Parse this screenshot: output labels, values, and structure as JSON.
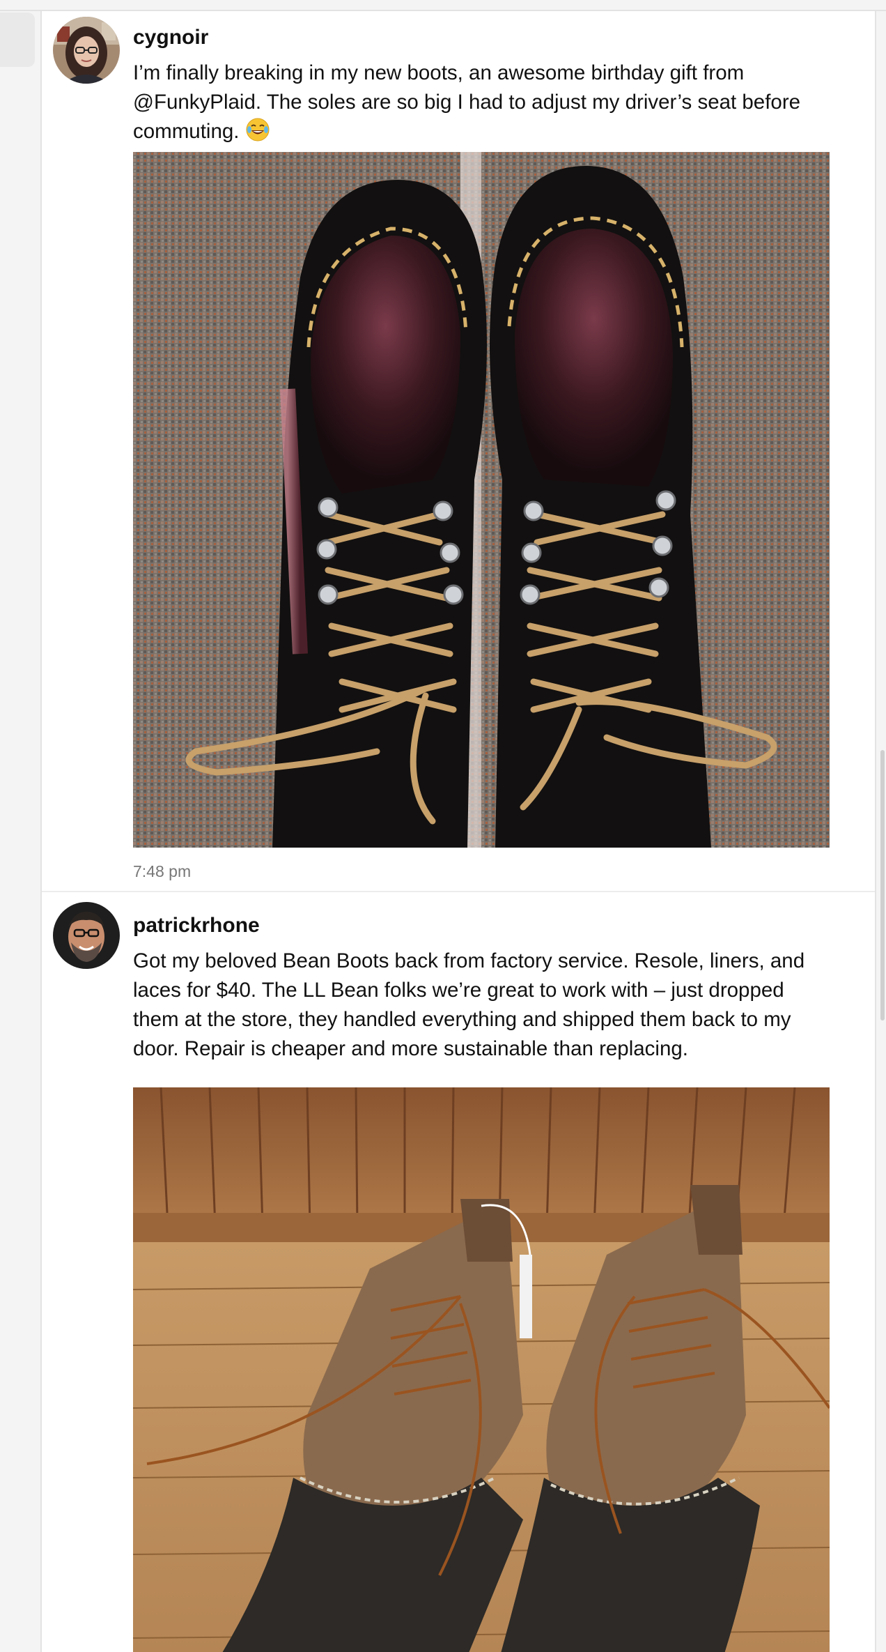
{
  "posts": [
    {
      "username": "cygnoir",
      "text_lines": [
        "I’m finally breaking in my new boots, an awesome birthday gift from",
        "@FunkyPlaid. The soles are so big I had to adjust my driver’s seat before",
        "commuting."
      ],
      "emoji": "face-with-tears-of-joy",
      "image": "black-cherry-leather-platform-boots-on-carpet",
      "timestamp": "7:48 pm"
    },
    {
      "username": "patrickrhone",
      "text_lines": [
        "Got my beloved Bean Boots back from factory service. Resole, liners, and",
        "laces for $40. The LL Bean folks we’re great to work with – just dropped",
        "them at the store, they handled everything and shipped them back to my",
        "door. Repair is cheaper and more sustainable than replacing."
      ],
      "image": "brown-duck-boots-on-wood-floor"
    }
  ],
  "colors": {
    "page_bg": "#f4f4f4",
    "card_bg": "#ffffff",
    "divider": "#ececec",
    "timestamp": "#777777",
    "text": "#111111"
  }
}
